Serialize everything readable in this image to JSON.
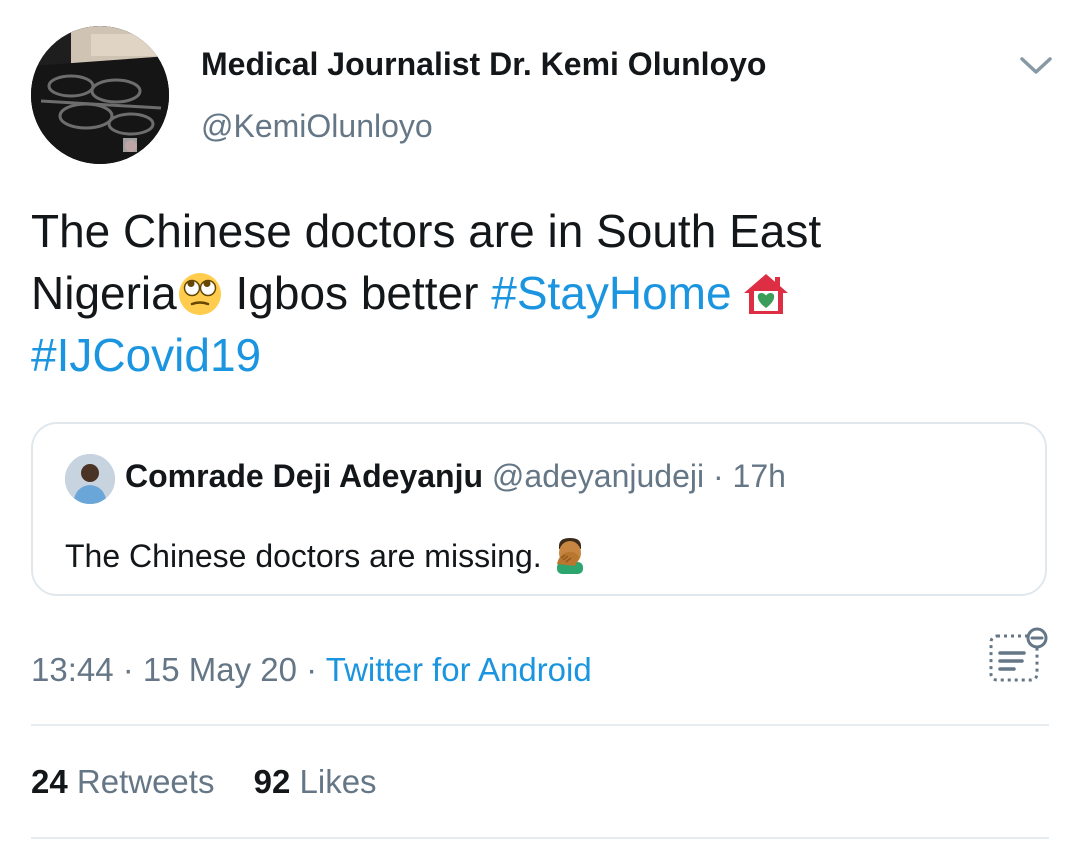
{
  "author": {
    "display_name": "Medical Journalist Dr. Kemi Olunloyo",
    "handle": "@KemiOlunloyo"
  },
  "tweet": {
    "line1": "The Chinese doctors are in South East",
    "line2_text": "Nigeria",
    "line2_emoji": "face-with-rolling-eyes-icon",
    "line2_after": " Igbos better ",
    "hashtag_stayhome": "#StayHome",
    "house_emoji": "house-with-heart-icon",
    "hashtag_covid": "#IJCovid19"
  },
  "quoted_tweet": {
    "display_name": "Comrade Deji Adeyanju",
    "handle": "@adeyanjudeji",
    "separator": " · ",
    "time": "17h",
    "text": "The Chinese doctors are missing. ",
    "emoji": "man-facepalming-icon"
  },
  "meta": {
    "time": "13:44",
    "sep1": " · ",
    "date": "15 May 20",
    "sep2": " · ",
    "source": "Twitter for Android"
  },
  "stats": {
    "retweets_count": "24",
    "retweets_label": "Retweets",
    "likes_count": "92",
    "likes_label": "Likes"
  },
  "colors": {
    "link": "#1b95e0",
    "secondary_text": "#657786",
    "border": "#e1e8ed"
  }
}
